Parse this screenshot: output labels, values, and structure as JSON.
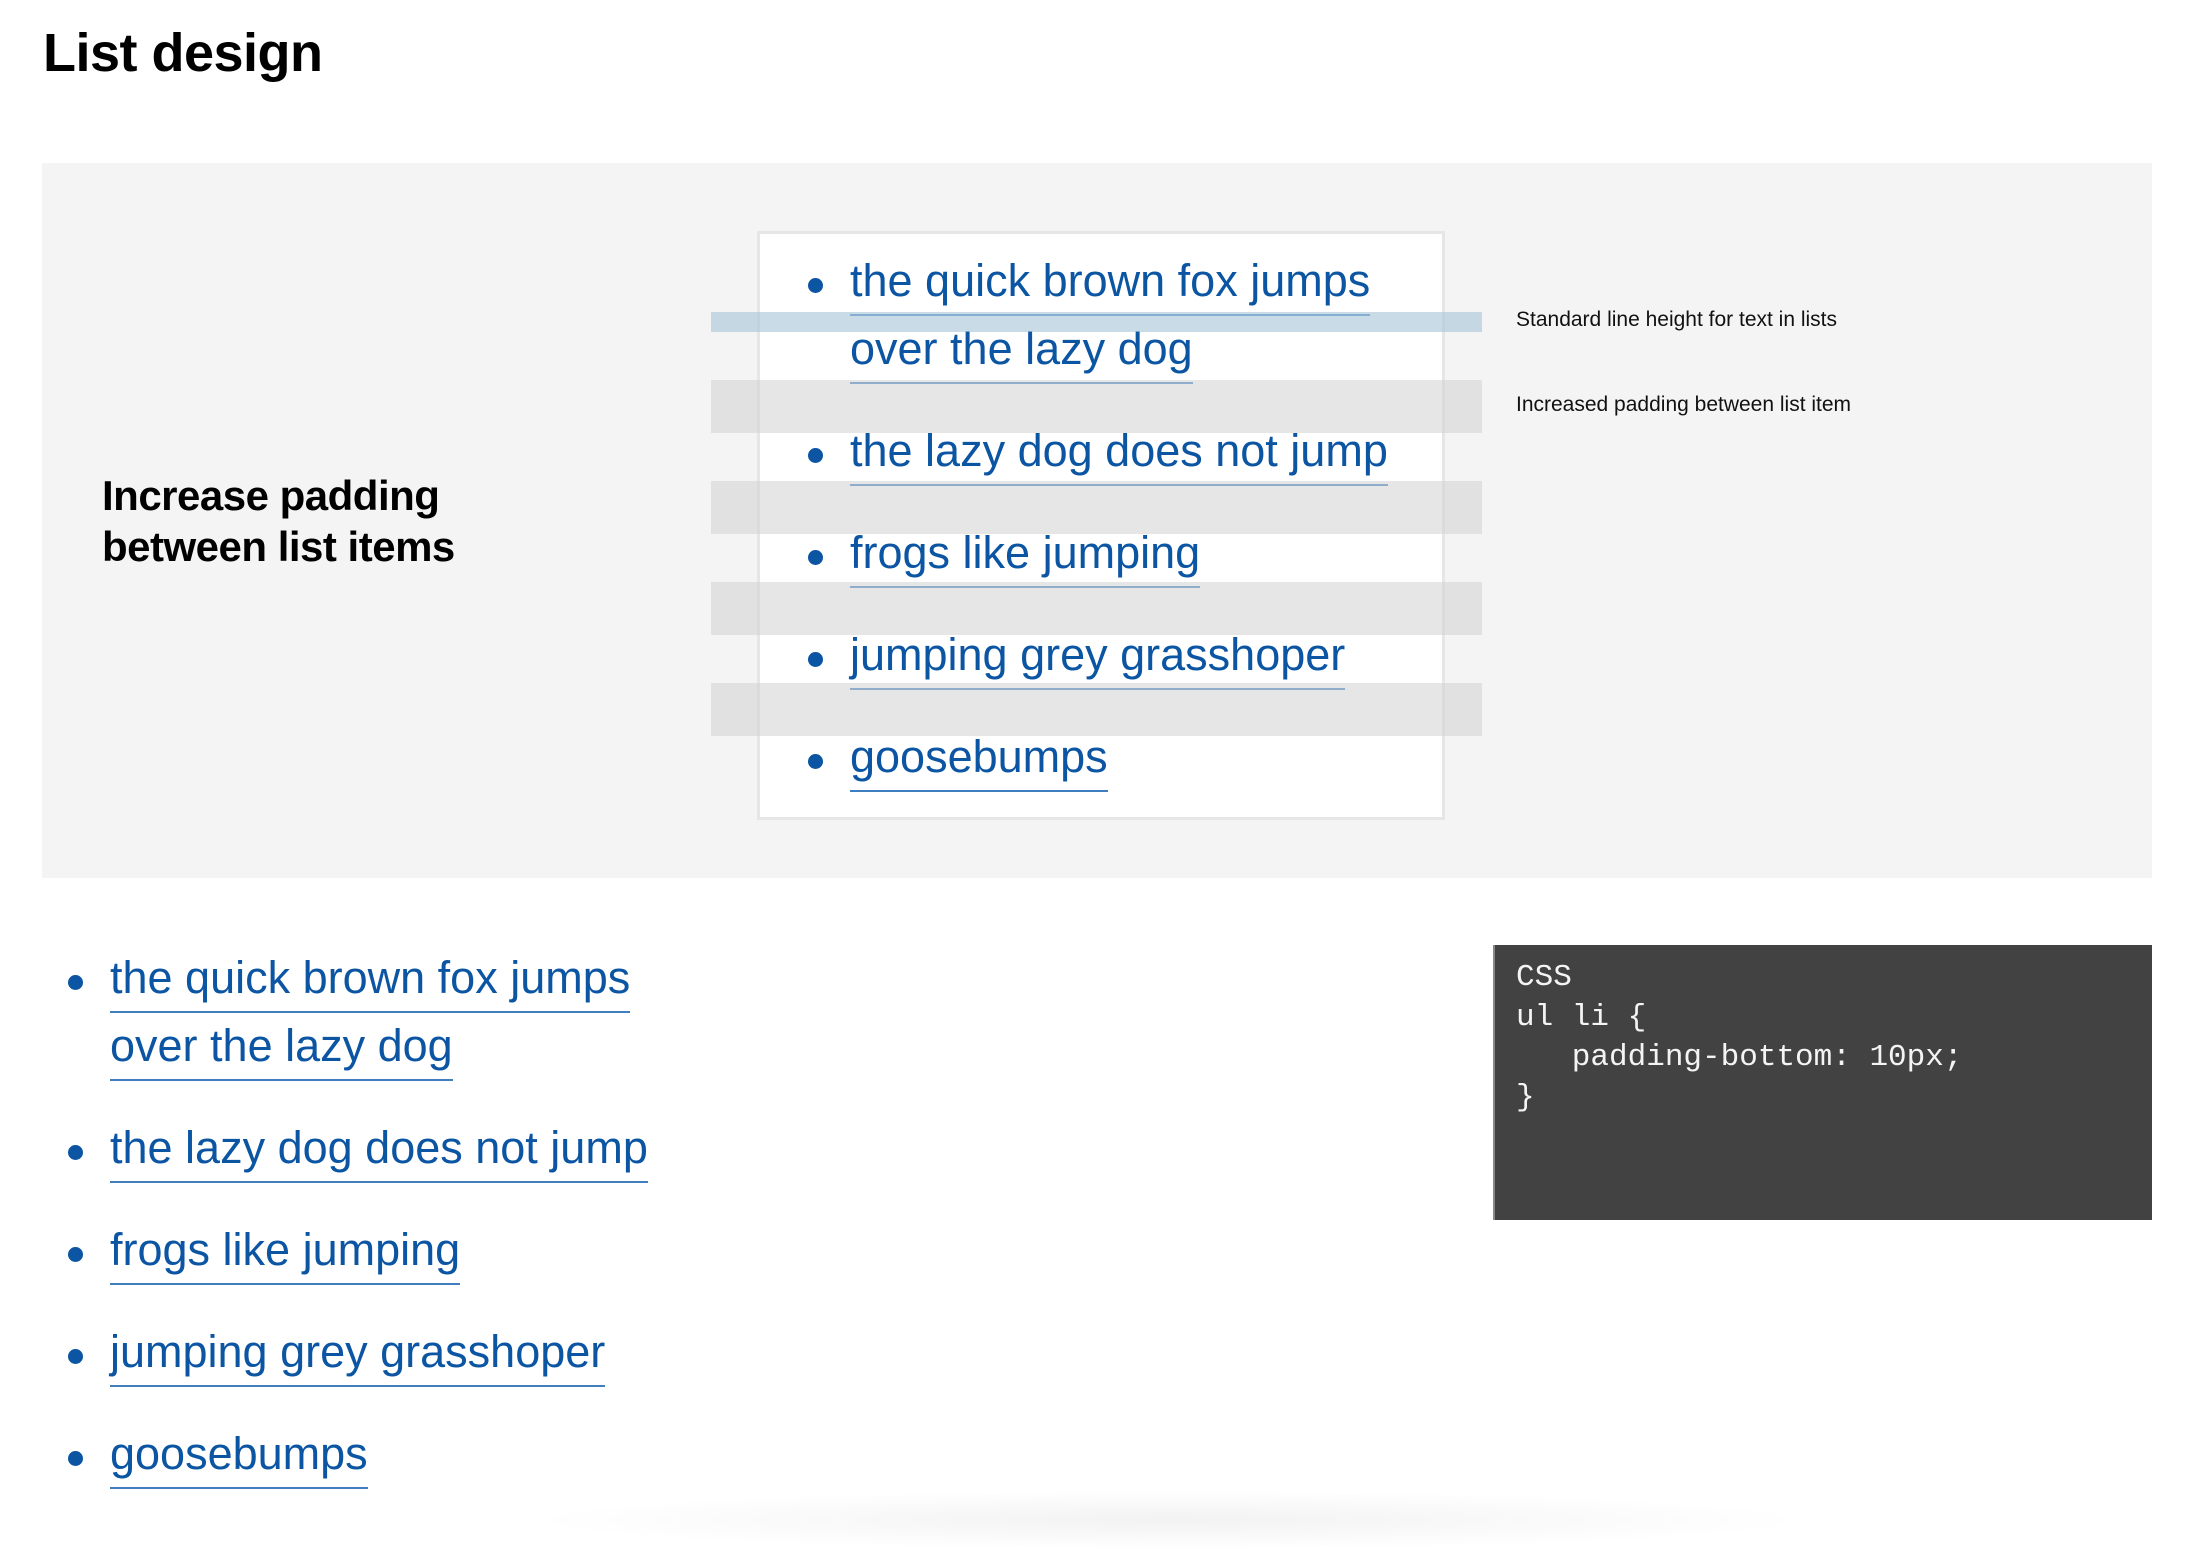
{
  "page": {
    "title": "List design"
  },
  "panel": {
    "heading_line1": "Increase padding",
    "heading_line2": "between list items",
    "annotations": {
      "line_height": "Standard line height for text in lists",
      "padding": "Increased padding between list item"
    },
    "colors": {
      "background": "#f4f4f4",
      "line_height_band": "#c6d9e4",
      "padding_band": "#e4e4e4"
    }
  },
  "list_items": [
    {
      "lines": [
        "the quick brown fox jumps",
        "over the lazy dog"
      ]
    },
    {
      "lines": [
        "the lazy dog does not jump"
      ]
    },
    {
      "lines": [
        "frogs like jumping"
      ]
    },
    {
      "lines": [
        "jumping grey grasshoper"
      ]
    },
    {
      "lines": [
        "goosebumps"
      ]
    }
  ],
  "link_color": "#0b55a3",
  "code": {
    "label": "CSS",
    "lines": [
      "ul li {",
      "   padding-bottom: 10px;",
      "}"
    ],
    "background": "#424242"
  }
}
